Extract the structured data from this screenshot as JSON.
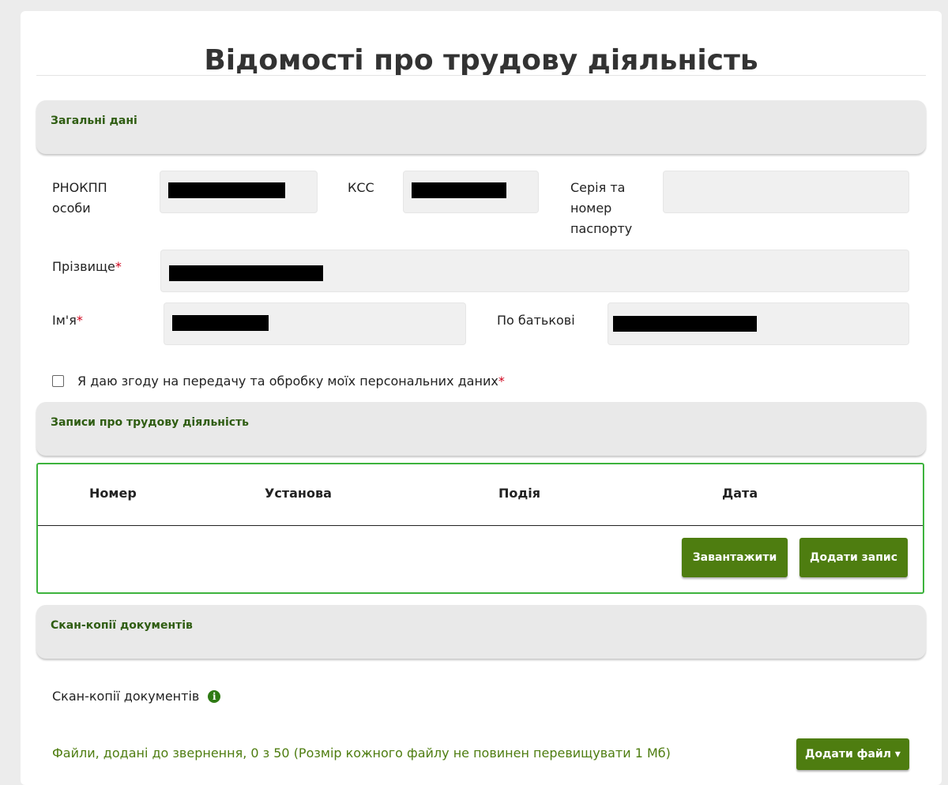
{
  "page": {
    "title": "Відомості про трудову діяльність"
  },
  "general": {
    "header": "Загальні дані",
    "rnokpp_label_1": "РНОКПП",
    "rnokpp_label_2": "особи",
    "kss_label": "КСС",
    "passport_label_1": "Серія та",
    "passport_label_2": "номер",
    "passport_label_3": "паспорту",
    "surname_label": "Прізвище",
    "name_label": "Ім'я",
    "patronymic_label": "По батькові",
    "required_mark": "*"
  },
  "consent": {
    "label": "Я даю згоду на передачу та обробку моїх персональних даних",
    "required_mark": "*",
    "checked": false
  },
  "records": {
    "header": "Записи про трудову діяльність",
    "columns": [
      "Номер",
      "Установа",
      "Подія",
      "Дата"
    ],
    "upload_button": "Завантажити",
    "add_button": "Додати запис"
  },
  "scans": {
    "header": "Скан-копії документів",
    "label": "Скан-копії документів",
    "files_text": "Файли, додані до звернення, 0 з 50 (Розмір кожного файлу не повинен перевищувати 1 Мб)",
    "add_file_button": "Додати файл ▾"
  },
  "colors": {
    "accent_green": "#4e7d10",
    "header_green": "#2f5d12",
    "table_border": "#3db33d",
    "required_red": "#d0021b"
  }
}
